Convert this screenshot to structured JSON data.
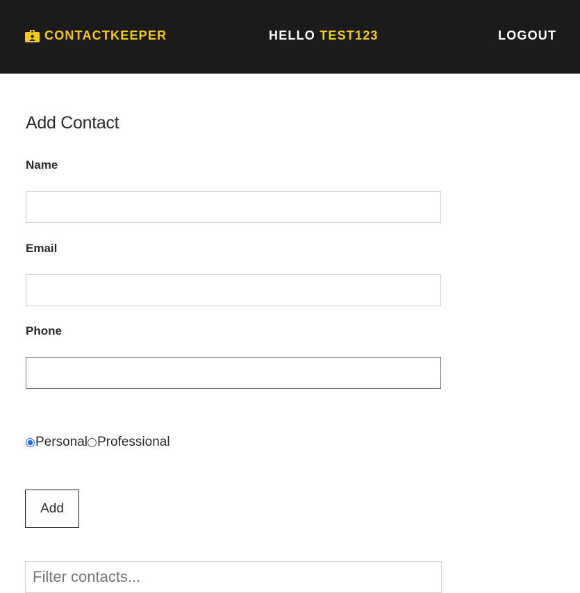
{
  "navbar": {
    "brand": "CONTACTKEEPER",
    "brand_icon": "id-badge-icon",
    "greeting_prefix": "HELLO",
    "username": "TEST123",
    "logout_label": "LOGOUT",
    "background_color": "#1b1b1b",
    "accent_color": "#f5cb11"
  },
  "form": {
    "title": "Add Contact",
    "name_label": "Name",
    "name_value": "",
    "email_label": "Email",
    "email_value": "",
    "phone_label": "Phone",
    "phone_value": "",
    "type_options": [
      {
        "label": "Personal",
        "checked": true
      },
      {
        "label": "Professional",
        "checked": false
      }
    ],
    "submit_label": "Add"
  },
  "filter": {
    "placeholder": "Filter contacts..."
  }
}
